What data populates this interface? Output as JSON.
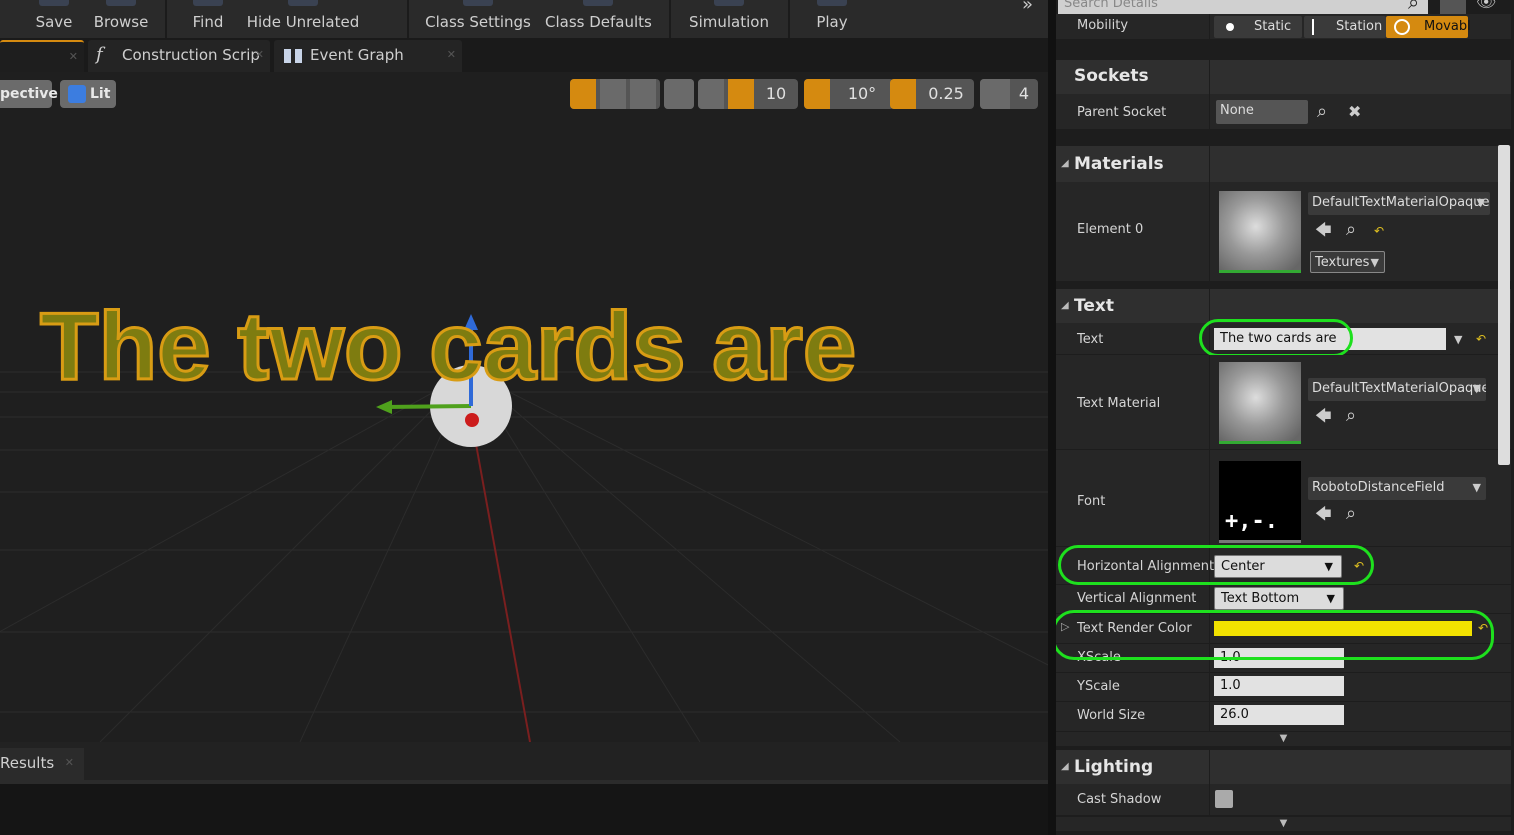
{
  "toolbar": {
    "buttons": [
      "Save",
      "Browse",
      "Find",
      "Hide Unrelated",
      "Class Settings",
      "Class Defaults",
      "Simulation",
      "Play"
    ],
    "overflow": "»"
  },
  "tabs": {
    "construction": "Construction Scrip",
    "event_graph": "Event Graph",
    "construction_icon": "f"
  },
  "viewport": {
    "perspective": "pective",
    "lit": "Lit",
    "grid_snap": "10",
    "rotation_snap": "10°",
    "scale_snap": "0.25",
    "camera_speed": "4",
    "text_render": "The two cards are"
  },
  "results": {
    "tab": "Results"
  },
  "details": {
    "search_placeholder": "Search Details",
    "mobility": {
      "label": "Mobility",
      "options": [
        "Static",
        "Station",
        "Movabl"
      ],
      "selected": "Movabl"
    },
    "sockets": {
      "title": "Sockets",
      "parent_socket_label": "Parent Socket",
      "parent_socket_value": "None"
    },
    "materials": {
      "title": "Materials",
      "element_label": "Element 0",
      "element_value": "DefaultTextMaterialOpaque",
      "textures": "Textures"
    },
    "text": {
      "title": "Text",
      "text_label": "Text",
      "text_value": "The two cards are",
      "material_label": "Text Material",
      "material_value": "DefaultTextMaterialOpaque",
      "font_label": "Font",
      "font_value": "RobotoDistanceField",
      "halign_label": "Horizontal Alignment",
      "halign_value": "Center",
      "valign_label": "Vertical Alignment",
      "valign_value": "Text Bottom",
      "color_label": "Text Render Color",
      "color_value": "#f2e200",
      "xscale_label": "XScale",
      "xscale_value": "1.0",
      "yscale_label": "YScale",
      "yscale_value": "1.0",
      "worldsize_label": "World Size",
      "worldsize_value": "26.0"
    },
    "lighting": {
      "title": "Lighting",
      "cast_shadow_label": "Cast Shadow"
    }
  }
}
